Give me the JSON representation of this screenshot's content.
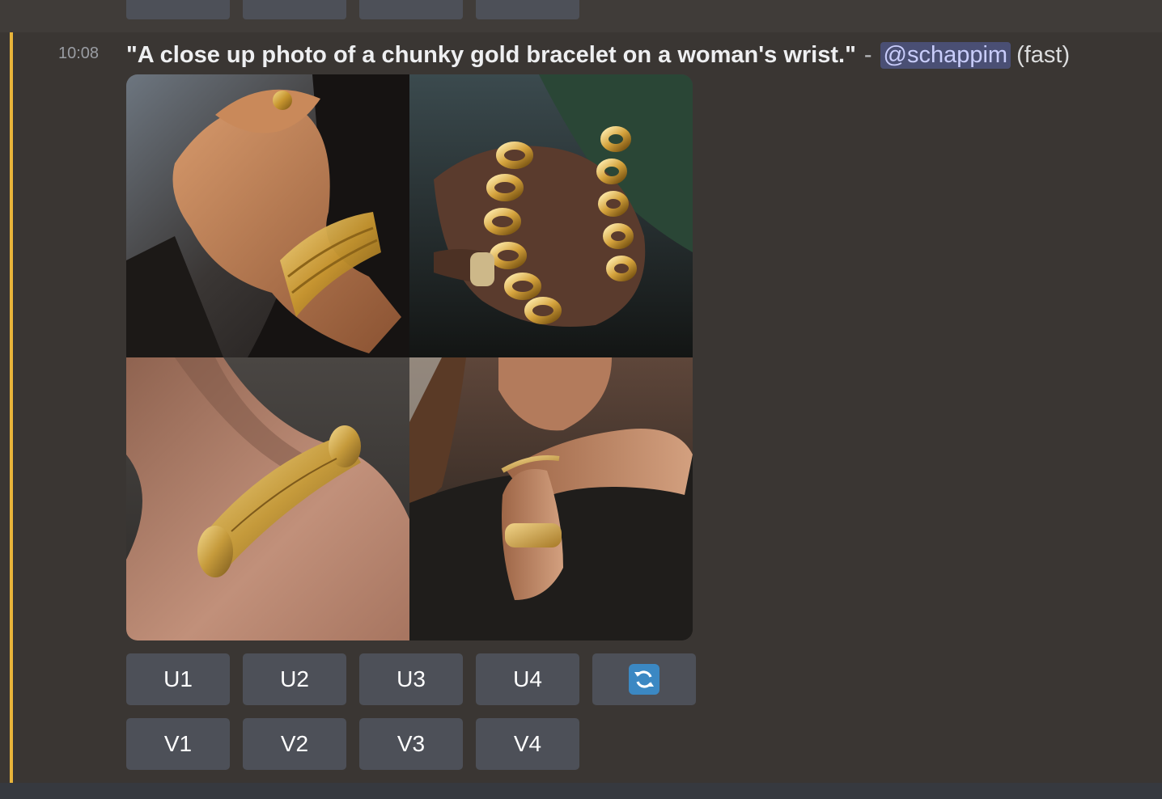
{
  "message": {
    "timestamp": "10:08",
    "prompt": "\"A close up photo of a chunky gold bracelet on a woman's wrist.\"",
    "separator": "-",
    "mention": "@schappim",
    "mode": "(fast)"
  },
  "images": [
    {
      "icon": "photo-icon"
    },
    {
      "icon": "photo-icon"
    },
    {
      "icon": "photo-icon"
    },
    {
      "icon": "photo-icon"
    }
  ],
  "upscale_buttons": [
    "U1",
    "U2",
    "U3",
    "U4"
  ],
  "reroll_icon": "refresh-icon",
  "variation_buttons": [
    "V1",
    "V2",
    "V3",
    "V4"
  ],
  "colors": {
    "background": "#403c39",
    "highlight": "#e8b43a",
    "button": "#4d5058",
    "mention_bg": "#4a4f74",
    "mention_text": "#c9cdfb",
    "reroll": "#3b88c3"
  }
}
